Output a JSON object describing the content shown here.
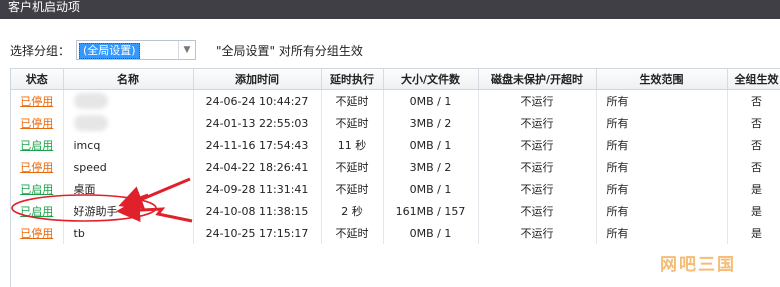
{
  "window": {
    "title": "客户机启动项"
  },
  "group": {
    "label": "选择分组：",
    "selected": "(全局设置)",
    "note": "\"全局设置\" 对所有分组生效"
  },
  "table": {
    "columns": [
      "状态",
      "名称",
      "添加时间",
      "延时执行",
      "大小/文件数",
      "磁盘未保护/开超时",
      "生效范围",
      "全组生效"
    ],
    "rows": [
      {
        "status": "已停用",
        "status_type": "disabled",
        "name": "",
        "time": "24-06-24 10:44:27",
        "delay": "不延时",
        "size": "0MB / 1",
        "disk": "不运行",
        "scope": "所有",
        "all": "否"
      },
      {
        "status": "已停用",
        "status_type": "disabled",
        "name": "",
        "time": "24-01-13 22:55:03",
        "delay": "不延时",
        "size": "3MB / 2",
        "disk": "不运行",
        "scope": "所有",
        "all": "否"
      },
      {
        "status": "已启用",
        "status_type": "enabled",
        "name": "imcq",
        "time": "24-11-16 17:54:43",
        "delay": "11 秒",
        "size": "0MB / 1",
        "disk": "不运行",
        "scope": "所有",
        "all": "否"
      },
      {
        "status": "已停用",
        "status_type": "disabled",
        "name": "speed",
        "time": "24-04-22 18:26:41",
        "delay": "不延时",
        "size": "3MB / 2",
        "disk": "不运行",
        "scope": "所有",
        "all": "否"
      },
      {
        "status": "已启用",
        "status_type": "enabled",
        "name": "桌面",
        "time": "24-09-28 11:31:41",
        "delay": "不延时",
        "size": "0MB / 1",
        "disk": "不运行",
        "scope": "所有",
        "all": "是"
      },
      {
        "status": "已启用",
        "status_type": "enabled",
        "name": "好游助手",
        "time": "24-10-08 11:38:15",
        "delay": "2 秒",
        "size": "161MB / 157",
        "disk": "不运行",
        "scope": "所有",
        "all": "是"
      },
      {
        "status": "已停用",
        "status_type": "disabled",
        "name": "tb",
        "time": "24-10-25 17:15:17",
        "delay": "不延时",
        "size": "0MB / 1",
        "disk": "不运行",
        "scope": "所有",
        "all": "是"
      }
    ]
  },
  "watermark": "网吧三国",
  "colors": {
    "disabled": "#e8690b",
    "enabled": "#1aa34a",
    "annotation": "#e0202a",
    "selection": "#3399ff"
  }
}
